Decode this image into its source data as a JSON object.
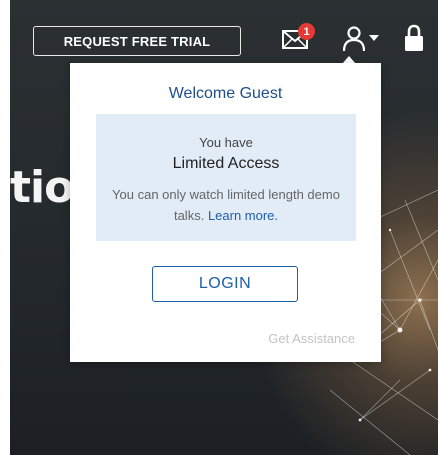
{
  "header": {
    "trial_button_label": "REQUEST FREE TRIAL",
    "notification_count": "1"
  },
  "hero": {
    "title_fragment": "tio"
  },
  "dropdown": {
    "welcome_text": "Welcome Guest",
    "access_intro": "You have",
    "access_level": "Limited Access",
    "access_note": "You can only watch limited length demo talks.",
    "learn_more_link": "Learn more.",
    "login_button_label": "LOGIN",
    "assistance_link": "Get Assistance"
  },
  "colors": {
    "brand_blue": "#1f5ea8",
    "badge_red": "#e53935",
    "access_box_bg": "#e2ecf7"
  },
  "icons": [
    "mail-icon",
    "user-icon",
    "chevron-down-icon",
    "lock-icon"
  ]
}
